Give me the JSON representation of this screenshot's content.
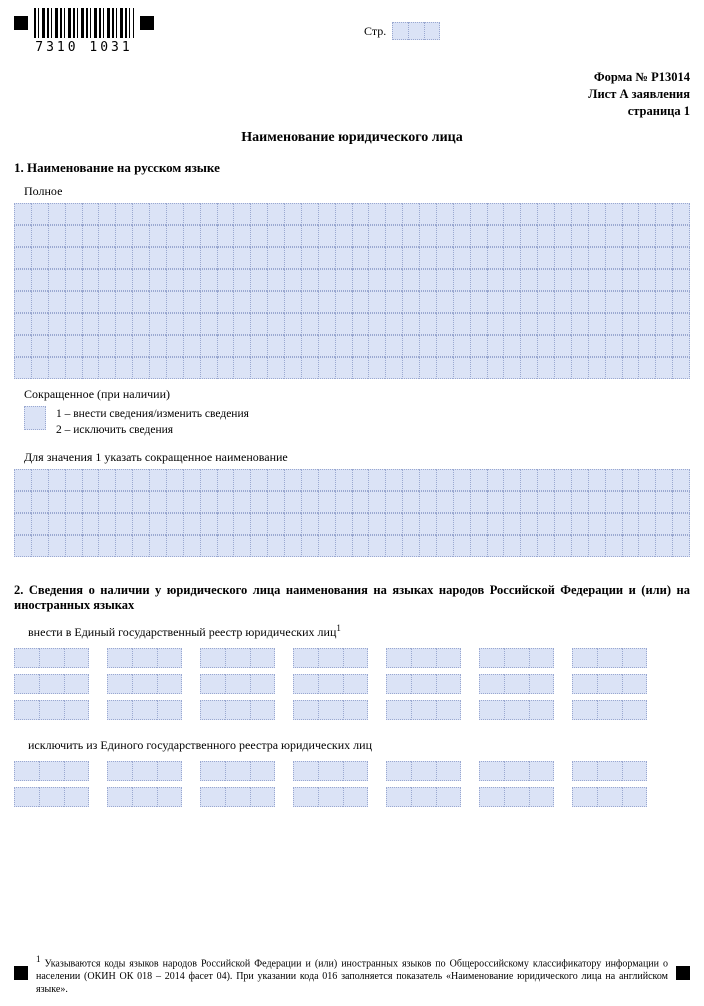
{
  "barcode_number": "7310 1031",
  "page_label": "Стр.",
  "header": {
    "form": "Форма № Р13014",
    "sheet": "Лист А заявления",
    "page": "страница 1"
  },
  "title": "Наименование юридического лица",
  "section1": {
    "heading": "1. Наименование на русском языке",
    "full_label": "Полное",
    "short_label": "Сокращенное (при наличии)",
    "opt1": "1 – внести сведения/изменить сведения",
    "opt2": "2 – исключить сведения",
    "short_instr": "Для значения 1 указать сокращенное наименование"
  },
  "section2": {
    "heading": "2. Сведения о наличии у юридического лица наименования на языках народов Российской Федерации и (или) на иностранных языках",
    "include_label": "внести в Единый государственный реестр юридических лиц",
    "exclude_label": "исключить из Единого государственного реестра юридических лиц"
  },
  "footnote": {
    "marker": "1",
    "text": "Указываются коды языков народов Российской Федерации и (или) иностранных языков по Общероссийскому классификатору информации о населении (ОКИН ОК 018 – 2014 фасет 04). При указании кода 016 заполняется показатель «Наименование юридического лица на английском языке»."
  }
}
